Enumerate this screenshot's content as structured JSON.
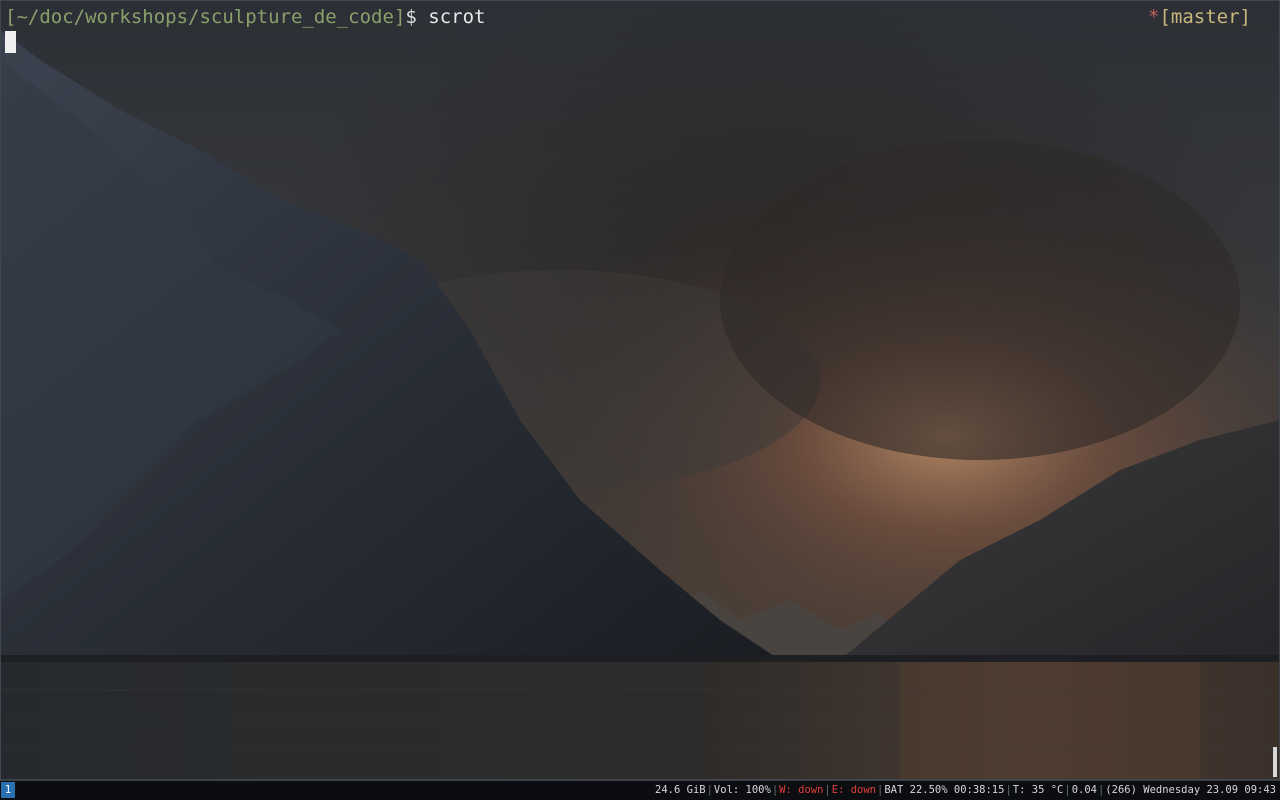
{
  "terminal": {
    "prompt": {
      "open": "[",
      "path": "~/doc/workshops/sculpture_de_code",
      "close": "]",
      "symbol": "$ "
    },
    "command": "scrot",
    "git": {
      "dirty_marker": "*",
      "branch": "[master]"
    }
  },
  "statusbar": {
    "workspace": "1",
    "blocks": [
      {
        "text": "24.6 GiB",
        "state": "normal"
      },
      {
        "text": "Vol: 100%",
        "state": "normal"
      },
      {
        "text": "W: down",
        "state": "bad"
      },
      {
        "text": "E: down",
        "state": "bad"
      },
      {
        "text": "BAT 22.50% 00:38:15",
        "state": "normal"
      },
      {
        "text": "T: 35 °C",
        "state": "normal"
      },
      {
        "text": "0.04",
        "state": "normal"
      },
      {
        "text": "(266) Wednesday 23.09 09:43",
        "state": "normal"
      }
    ]
  },
  "colors": {
    "prompt_green": "#8aa06a",
    "git_dirty_red": "#c0605a",
    "git_branch_yellow": "#c9b77a",
    "status_bad_red": "#e0403a",
    "workspace_blue": "#2a6fb0"
  }
}
